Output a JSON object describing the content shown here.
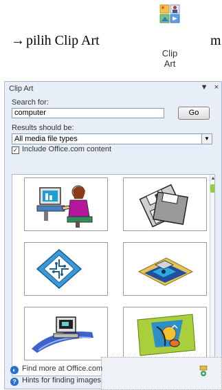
{
  "caption": {
    "arrow": "→",
    "text": "pilih Clip Art",
    "tail": "m",
    "ribbon_label_1": "Clip",
    "ribbon_label_2": "Art",
    "ribbon_icon": "clip-art-icon"
  },
  "pane": {
    "title": "Clip Art",
    "menu_glyph": "▼",
    "close_glyph": "×",
    "search_label": "Search for:",
    "search_value": "computer",
    "go_label": "Go",
    "results_label": "Results should be:",
    "results_value": "All media file types",
    "include_label": "Include Office.com content",
    "include_checked": "☑",
    "thumbnails": [
      {
        "icon": "person-at-computer-icon"
      },
      {
        "icon": "floppy-disks-icon"
      },
      {
        "icon": "circuit-board-icon"
      },
      {
        "icon": "floppy-disk-icon"
      },
      {
        "icon": "computer-hand-icon"
      },
      {
        "icon": "computer-mouse-icon"
      }
    ],
    "links": {
      "find_more": "Find more at Office.com",
      "hints": "Hints for finding images"
    }
  },
  "colors": {
    "pane_bg": "#e8eef7",
    "scroll_thumb": "#8fcf3a"
  }
}
